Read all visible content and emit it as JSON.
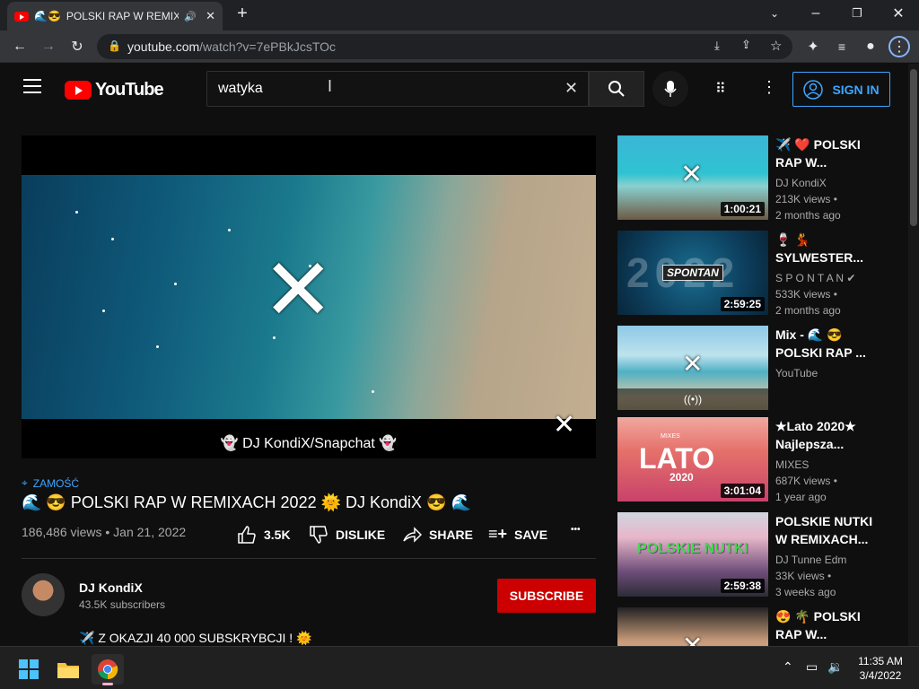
{
  "browser": {
    "tab_title": "POLSKI RAP W REMIXACH",
    "url_host": "youtube.com",
    "url_path": "/watch?v=7ePBkJcsTOc",
    "new_tab": "+",
    "minimize": "–",
    "restore": "❐",
    "close": "✕"
  },
  "header": {
    "logo_text": "YouTube",
    "search_value": "watyka",
    "sign_in": "SIGN IN"
  },
  "player": {
    "caption": "👻 DJ KondiX/Snapchat 👻"
  },
  "video": {
    "location_tag": "ZAMOŚĆ",
    "title": "🌊 😎 POLSKI RAP W REMIXACH 2022 🌞 DJ KondiX 😎 🌊",
    "stats": "186,486 views • Jan 21, 2022",
    "likes": "3.5K",
    "dislike": "DISLIKE",
    "share": "SHARE",
    "save": "SAVE",
    "more": "•••"
  },
  "channel": {
    "name": "DJ KondiX",
    "subscribers": "43.5K subscribers",
    "subscribe": "SUBSCRIBE",
    "description": "✈️ Z OKAZJI 40 000 SUBSKRYBCJI ! 🌞"
  },
  "recommendations": [
    {
      "title": "✈️ ❤️ POLSKI RAP W...",
      "channel": "DJ KondiX",
      "views": "213K views •",
      "age": "2 months ago",
      "duration": "1:00:21"
    },
    {
      "title": "🍷 💃 SYLWESTER...",
      "channel": "S P O N T A N",
      "views": "533K views •",
      "age": "2 months ago",
      "duration": "2:59:25"
    },
    {
      "title": "Mix - 🌊 😎 POLSKI RAP ...",
      "channel": "YouTube",
      "views": "",
      "age": "",
      "duration": ""
    },
    {
      "title": "★Lato 2020★ Najlepsza...",
      "channel": "MIXES",
      "views": "687K views •",
      "age": "1 year ago",
      "duration": "3:01:04"
    },
    {
      "title": "POLSKIE NUTKI W REMIXACH...",
      "channel": "DJ Tunne Edm",
      "views": "33K views •",
      "age": "3 weeks ago",
      "duration": "2:59:38"
    },
    {
      "title": "😍 🌴 POLSKI RAP W...",
      "channel": "",
      "views": "",
      "age": "",
      "duration": ""
    }
  ],
  "thumb_text": {
    "spontan": "SPONTAN",
    "year": "2022",
    "mixes": "MIXES",
    "lato": "LATO",
    "lato_year": "2020",
    "nutki": "POLSKIE NUTKI",
    "live": "((•))"
  },
  "taskbar": {
    "time": "11:35 AM",
    "date": "3/4/2022"
  }
}
